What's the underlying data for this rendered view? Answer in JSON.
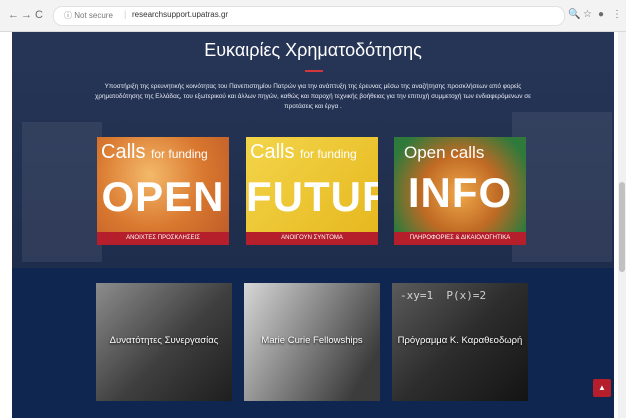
{
  "browser": {
    "back": "←",
    "forward": "→",
    "reload": "C",
    "info_icon": "ⓘ",
    "secure_label": "Not secure",
    "url": "researchsupport.upatras.gr",
    "search_icon": "🔍",
    "star_icon": "☆",
    "account_icon": "●",
    "menu_icon": "⋮"
  },
  "hero": {
    "title": "Ευκαιρίες Χρηματοδότησης",
    "text": "Υποστήριξη της ερευνητικής κοινότητας του Πανεπιστημίου Πατρών για την ανάπτυξη της έρευνας μέσω της αναζήτησης προσκλήσεων από φορείς χρηματοδότησης της Ελλάδας, του εξωτερικού και άλλων πηγών, καθώς και παροχή τεχνικής βοήθειας για την επιτυχή συμμετοχή των ενδιαφερόμενων σε προτάσεις και έργα ."
  },
  "cards": [
    {
      "top": "Calls",
      "top_small": "for funding",
      "big": "OPEN",
      "label": "ΑΝΟΙΧΤΕΣ ΠΡΟΣΚΛΗΣΕΙΣ"
    },
    {
      "top": "Calls",
      "top_small": "for funding",
      "big": "FUTURE",
      "label": "ΑΝΟΙΓΟΥΝ ΣΥΝΤΟΜΑ"
    },
    {
      "top": "Open calls",
      "top_small": "",
      "big": "INFO",
      "label": "ΠΛΗΡΟΦΟΡΙΕΣ & ΔΙΚΑΙΟΛΟΓΗΤΙΚΑ"
    }
  ],
  "tiles": [
    {
      "label": "Δυνατότητες Συνεργασίας"
    },
    {
      "label": "Marie Curie Fellowships"
    },
    {
      "label": "Πρόγραμμα Κ. Καραθεοδωρή"
    }
  ],
  "scroll_top_icon": "▲",
  "colors": {
    "accent": "#b51e2b",
    "navy": "#0e2650"
  }
}
